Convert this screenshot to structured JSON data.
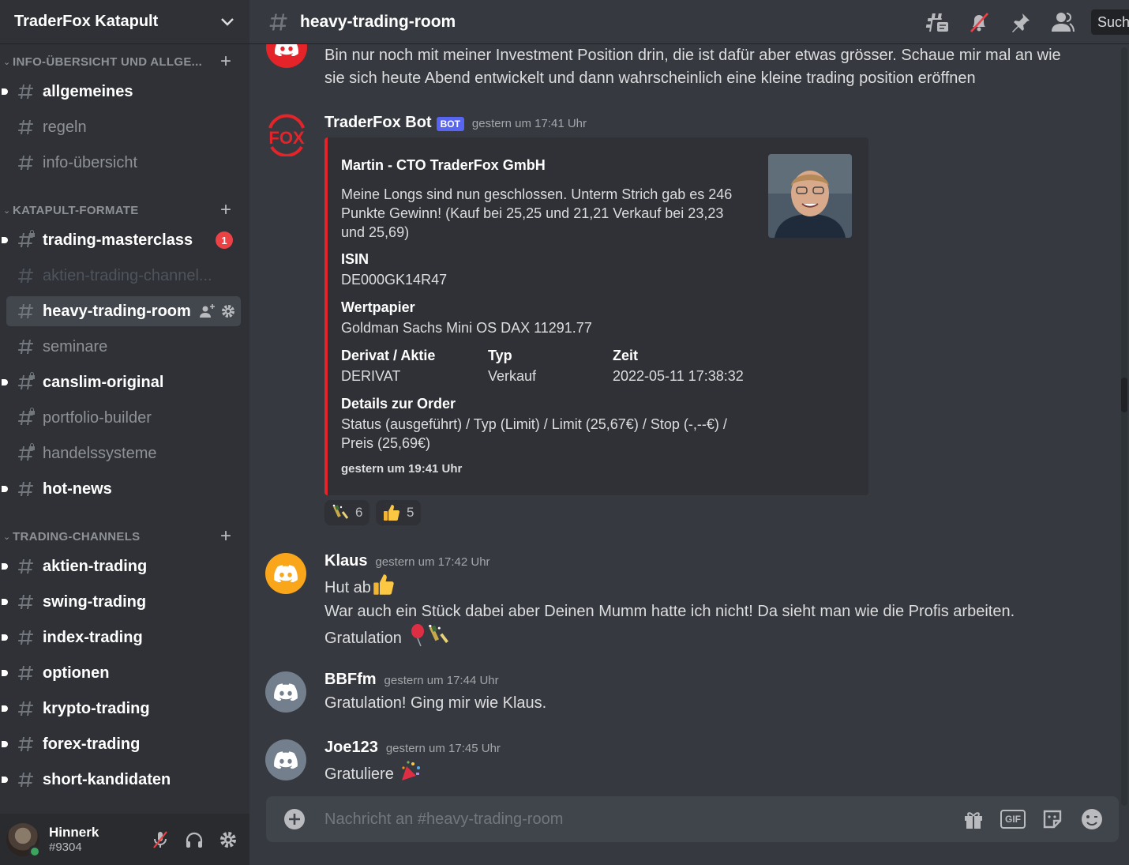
{
  "server": {
    "name": "TraderFox Katapult"
  },
  "categories": [
    {
      "label": "INFO-ÜBERSICHT UND ALLGE..."
    },
    {
      "label": "KATAPULT-FORMATE"
    },
    {
      "label": "TRADING-CHANNELS"
    }
  ],
  "channels": {
    "allgemeines": "allgemeines",
    "regeln": "regeln",
    "info_uebersicht": "info-übersicht",
    "trading_masterclass": "trading-masterclass",
    "trading_masterclass_mentions": "1",
    "aktien_trading_channel": "aktien-trading-channel...",
    "heavy_trading_room": "heavy-trading-room",
    "seminare": "seminare",
    "canslim_original": "canslim-original",
    "portfolio_builder": "portfolio-builder",
    "handelssysteme": "handelssysteme",
    "hot_news": "hot-news",
    "aktien_trading": "aktien-trading",
    "swing_trading": "swing-trading",
    "index_trading": "index-trading",
    "optionen": "optionen",
    "krypto_trading": "krypto-trading",
    "forex_trading": "forex-trading",
    "short_kandidaten": "short-kandidaten"
  },
  "user": {
    "name": "Hinnerk",
    "tag": "#9304",
    "status_color": "#3ba55d"
  },
  "topbar": {
    "channel": "heavy-trading-room",
    "search_label": "Such"
  },
  "messages": {
    "prev_text": "Bin nur noch mit meiner Investment Position drin, die ist dafür aber etwas grösser. Schaue mir mal an wie sie sich heute Abend entwickelt und dann wahrscheinlich eine kleine trading position eröffnen",
    "bot": {
      "author": "TraderFox Bot",
      "tag": "BOT",
      "timestamp": "gestern um 17:41 Uhr",
      "embed": {
        "title": "Martin - CTO TraderFox GmbH",
        "description": "Meine Longs sind nun geschlossen. Unterm Strich gab es 246 Punkte Gewinn! (Kauf bei 25,25 und 21,21 Verkauf bei 23,23 und 25,69)",
        "fields": {
          "isin_name": "ISIN",
          "isin_value": "DE000GK14R47",
          "wp_name": "Wertpapier",
          "wp_value": "Goldman Sachs Mini OS DAX 11291.77",
          "derivat_name": "Derivat / Aktie",
          "derivat_value": "DERIVAT",
          "typ_name": "Typ",
          "typ_value": "Verkauf",
          "zeit_name": "Zeit",
          "zeit_value": "2022-05-11 17:38:32",
          "details_name": "Details zur Order",
          "details_value": "Status (ausgeführt) / Typ (Limit) / Limit (25,67€) / Stop (-,--€) / Preis (25,69€)"
        },
        "footer": "gestern um 19:41 Uhr",
        "accent": "#e52429"
      },
      "reactions": [
        {
          "emoji": "champagne-icon",
          "count": "6"
        },
        {
          "emoji": "thumbs-up-icon",
          "count": "5"
        }
      ]
    },
    "klaus": {
      "author": "Klaus",
      "timestamp": "gestern um 17:42 Uhr",
      "line1": "Hut ab",
      "line2": "War auch ein Stück dabei aber Deinen Mumm hatte ich nicht! Da sieht man wie die Profis arbeiten.",
      "line3": "Gratulation",
      "avatar_color": "#faa61a"
    },
    "bbffm": {
      "author": "BBFfm",
      "timestamp": "gestern um 17:44 Uhr",
      "text": "Gratulation! Ging mir wie Klaus.",
      "avatar_color": "#747f8d"
    },
    "joe": {
      "author": "Joe123",
      "timestamp": "gestern um 17:45 Uhr",
      "text": "Gratuliere",
      "avatar_color": "#747f8d"
    }
  },
  "composer": {
    "placeholder": "Nachricht an #heavy-trading-room",
    "gif_label": "GIF"
  }
}
